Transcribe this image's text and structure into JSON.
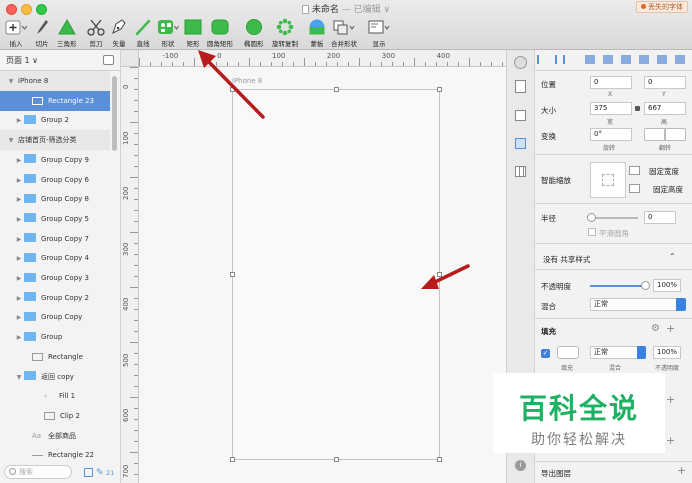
{
  "window": {
    "title": "未命名",
    "title_suffix": "— 已编辑 ∨",
    "badge": "丢失的字体"
  },
  "toolbar": {
    "insert": "插入",
    "slice": "切片",
    "triangle": "三角形",
    "scissors": "剪刀",
    "vector": "矢量",
    "line": "直线",
    "shape": "形状",
    "rectangle": "矩形",
    "rounded_rect": "圆角矩形",
    "oval": "椭圆形",
    "rotate_copy": "旋转复制",
    "mask": "蒙板",
    "combine": "合并形状",
    "display": "显示"
  },
  "sidebar": {
    "page_selector": "页面 1 ∨",
    "layers": [
      {
        "label": "iPhone 8",
        "type": "artboard"
      },
      {
        "label": "Rectangle 23",
        "type": "rect",
        "selected": true
      },
      {
        "label": "Group 2",
        "type": "folder"
      },
      {
        "label": "店铺首页-筛选分类",
        "type": "artboard"
      },
      {
        "label": "Group Copy 9",
        "type": "folder"
      },
      {
        "label": "Group Copy 6",
        "type": "folder"
      },
      {
        "label": "Group Copy 8",
        "type": "folder"
      },
      {
        "label": "Group Copy 5",
        "type": "folder"
      },
      {
        "label": "Group Copy 7",
        "type": "folder"
      },
      {
        "label": "Group Copy 4",
        "type": "folder"
      },
      {
        "label": "Group Copy 3",
        "type": "folder"
      },
      {
        "label": "Group Copy 2",
        "type": "folder"
      },
      {
        "label": "Group Copy",
        "type": "folder"
      },
      {
        "label": "Group",
        "type": "folder"
      },
      {
        "label": "Rectangle",
        "type": "rect"
      },
      {
        "label": "返回 copy",
        "type": "folder"
      },
      {
        "label": "Fill 1",
        "type": "path"
      },
      {
        "label": "Clip 2",
        "type": "rect"
      },
      {
        "label": "全部商品",
        "type": "text"
      },
      {
        "label": "Rectangle 22",
        "type": "line"
      }
    ],
    "search_placeholder": "搜索",
    "count": "21"
  },
  "canvas": {
    "artboard_label": "iPhone 8",
    "h_ticks": [
      "-100",
      "0",
      "100",
      "200",
      "300",
      "400"
    ],
    "v_ticks": [
      "0",
      "100",
      "200",
      "300",
      "400",
      "500",
      "600",
      "700"
    ]
  },
  "inspector": {
    "position_label": "位置",
    "x_value": "0",
    "y_value": "0",
    "x_caption": "X",
    "y_caption": "Y",
    "size_label": "大小",
    "width_value": "375",
    "height_value": "667",
    "width_caption": "宽",
    "height_caption": "高",
    "transform_label": "变换",
    "rotate_value": "0°",
    "rotate_caption": "旋转",
    "flip_caption": "翻转",
    "resizing_label": "智能缩放",
    "fixed_width": "固定宽度",
    "fixed_height": "固定高度",
    "radius_label": "半径",
    "radius_value": "0",
    "smooth_corners": "平滑圆角",
    "shared_style": "没有 共享样式",
    "opacity_label": "不透明度",
    "opacity_value": "100%",
    "blend_label": "混合",
    "blend_value": "正常",
    "fill_label": "填充",
    "fill_blend": "正常",
    "fill_opacity": "100%",
    "fill_caption": "填充",
    "fill_blend_caption": "混合",
    "fill_opacity_caption": "不透明度",
    "export_label": "导出图层"
  },
  "watermark": {
    "line1": "百科全说",
    "line2": "助你轻松解决"
  },
  "colors": {
    "selection": "#5b8fd8",
    "accent_green": "#3dbb4a",
    "arrow_red": "#b71c1c",
    "folder_blue": "#6fb6f0",
    "watermark_green": "#1eb063"
  }
}
